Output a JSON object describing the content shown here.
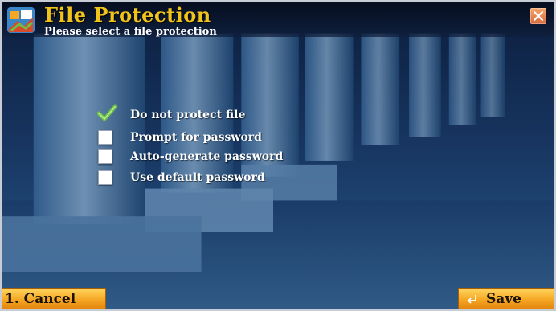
{
  "dialog": {
    "title": "File Protection",
    "subtitle": "Please select a file protection"
  },
  "options": [
    {
      "label": "Do not protect file",
      "selected": true
    },
    {
      "label": "Prompt for password",
      "selected": false
    },
    {
      "label": "Auto-generate password",
      "selected": false
    },
    {
      "label": "Use default password",
      "selected": false
    }
  ],
  "footer": {
    "cancel_label": "1. Cancel",
    "save_label": "Save"
  },
  "icons": {
    "app": "app-logo-icon",
    "close": "close-icon",
    "checked": "checkmark-icon",
    "save": "enter-arrow-icon"
  },
  "colors": {
    "title": "#f2c41a",
    "button": "#f5a623",
    "background": "#1b3c6b",
    "checkmark": "#6cc04a"
  }
}
